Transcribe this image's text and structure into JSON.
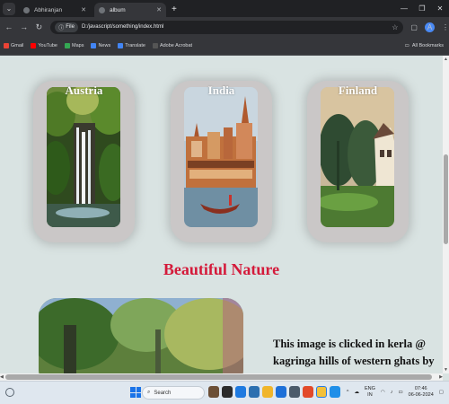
{
  "browser": {
    "tabs": [
      {
        "title": "Abhiranjan",
        "active": false
      },
      {
        "title": "album",
        "active": true
      }
    ],
    "new_tab_label": "+",
    "address": {
      "scheme_chip": "File",
      "url": "D:/javascript/something/index.html"
    },
    "bookmarks": [
      {
        "label": "Gmail",
        "color": "#ea4335"
      },
      {
        "label": "YouTube",
        "color": "#ff0000"
      },
      {
        "label": "Maps",
        "color": "#34a853"
      },
      {
        "label": "News",
        "color": "#4285f4"
      },
      {
        "label": "Translate",
        "color": "#4285f4"
      },
      {
        "label": "Adobe Acrobat",
        "color": "#333333"
      }
    ],
    "all_bookmarks_label": "All Bookmarks",
    "profile_initial": "A"
  },
  "page": {
    "cards": [
      {
        "title": "Austria",
        "icon": "waterfall-photo"
      },
      {
        "title": "India",
        "icon": "varanasi-ghat-photo"
      },
      {
        "title": "Finland",
        "icon": "house-trees-photo"
      }
    ],
    "heading": "Beautiful Nature",
    "caption": "This image is clicked in kerla @ kagringa hills of western ghats by our team member"
  },
  "taskbar": {
    "search_placeholder": "Search",
    "lang_line1": "ENG",
    "lang_line2": "IN",
    "time": "07:46",
    "date": "06-06-2024"
  },
  "colors": {
    "heading": "#d41a3a",
    "page_bg": "#d9e3e2",
    "card_bg": "#cac7c7"
  }
}
